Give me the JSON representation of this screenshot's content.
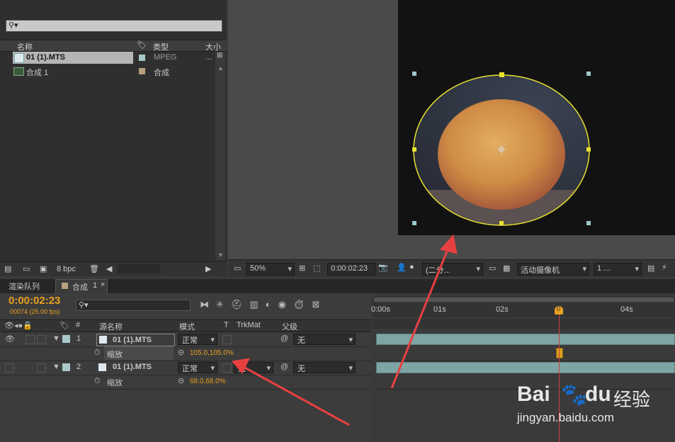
{
  "project": {
    "search_glyph": "⚲▾",
    "columns": {
      "name": "名称",
      "type": "类型",
      "size": "大小"
    },
    "items": [
      {
        "name": "01 (1).MTS",
        "type": "MPEG",
        "size": "..."
      },
      {
        "name": "合成 1",
        "type": "合成",
        "size": ""
      }
    ],
    "bpc_label": "8 bpc"
  },
  "viewer": {
    "zoom": "50%",
    "timecode": "0:00:02:23",
    "channel": "(二分...",
    "camera": "活动摄像机",
    "views": "1 ..."
  },
  "timeline": {
    "tabs": [
      {
        "label": "渲染队列"
      },
      {
        "label": "合成",
        "suffix": "1"
      }
    ],
    "current_time": "0:00:02:23",
    "frame_info": "00074 (25.00 fps)",
    "search_glyph": "⚲▾",
    "columns": {
      "num": "#",
      "source": "源名称",
      "mode": "模式",
      "t": "T",
      "trkmat": "TrkMat",
      "parent": "父级"
    },
    "layers": [
      {
        "num": "1",
        "name": "01 (1).MTS",
        "mode": "正常",
        "parent": "无",
        "prop": "缩放",
        "value": "105.0,105.0%"
      },
      {
        "num": "2",
        "name": "01 (1).MTS",
        "mode": "正常",
        "trkmat": "无",
        "parent": "无",
        "prop": "缩放",
        "value": "68.0,68.0%"
      }
    ],
    "ruler_ticks": [
      "0:00s",
      "01s",
      "02s",
      "04s"
    ],
    "playhead_label": "0"
  },
  "watermark": {
    "brand": "Bai",
    "brand2": "du",
    "cn": "经验",
    "url": "jingyan.baidu.com"
  },
  "colors": {
    "accent": "#e8a020",
    "ellipse": "#e8e030",
    "arrow": "#e84040",
    "layer_bar": "#7ea5a5"
  }
}
